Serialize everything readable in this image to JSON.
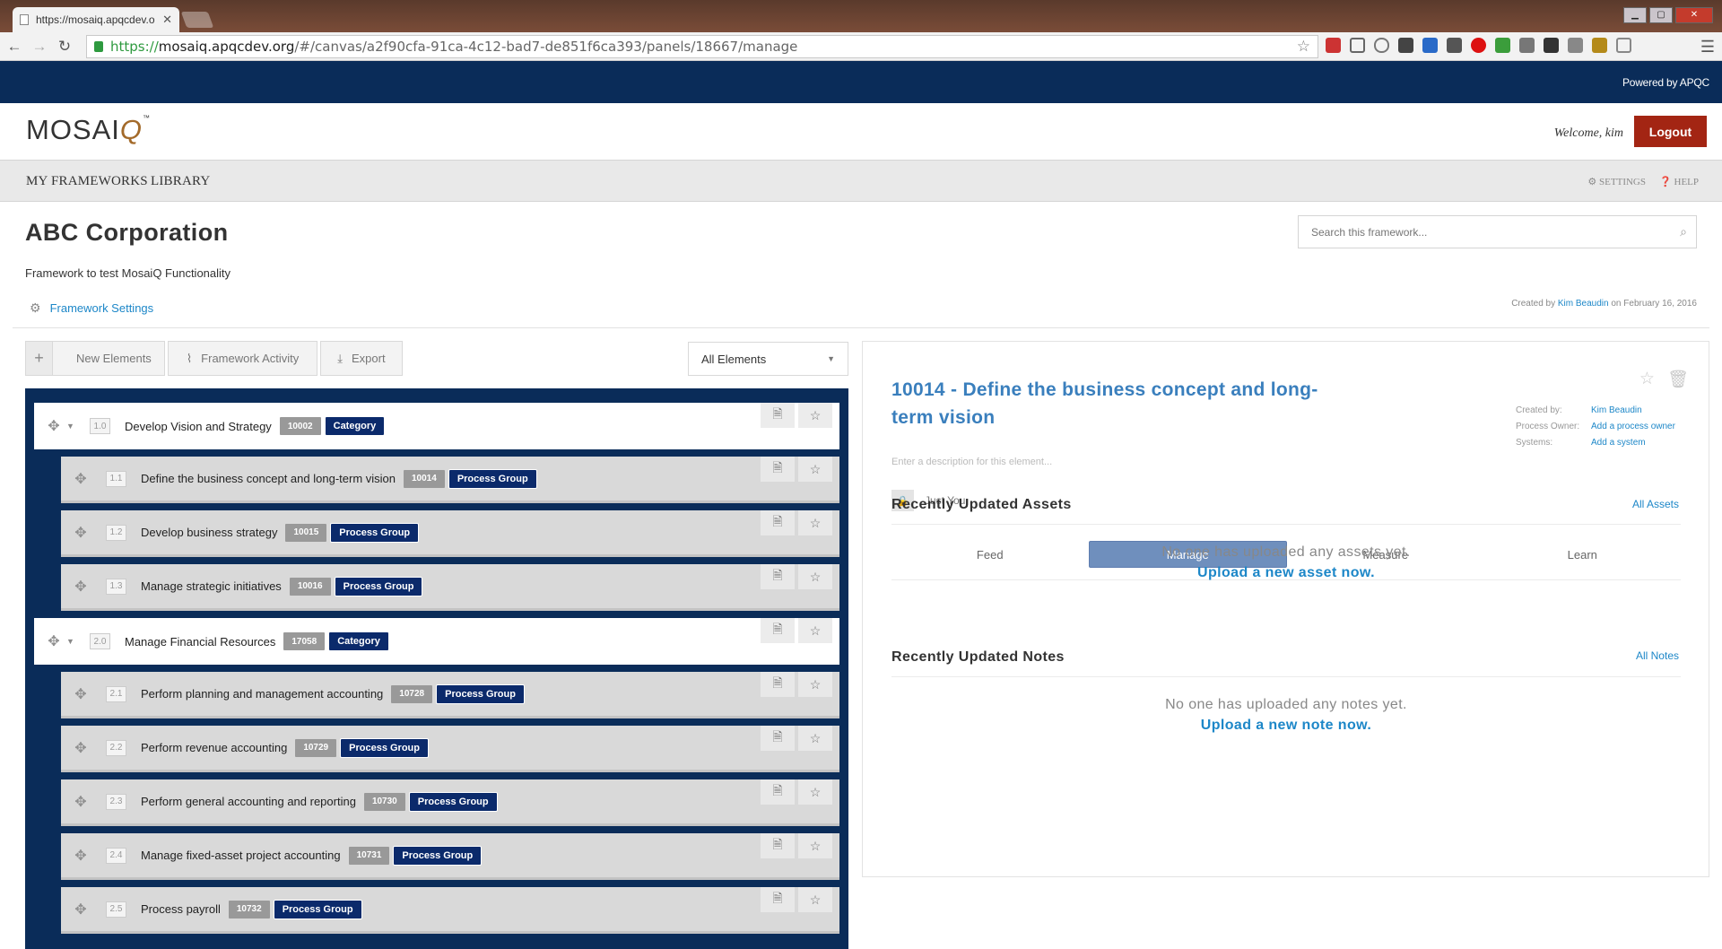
{
  "browser": {
    "tab_title": "https://mosaiq.apqcdev.o",
    "tab_close": "✕",
    "url_secure": "https://",
    "url_host": "mosaiq.apqcdev.org",
    "url_path": "/#/canvas/a2f90cfa-91ca-4c12-bad7-de851f6ca393/panels/18667/manage"
  },
  "topbar": {
    "powered_by": "Powered by APQC"
  },
  "header": {
    "logo_prefix": "MOSAI",
    "logo_q": "Q",
    "logo_tm": "™",
    "welcome": "Welcome, kim",
    "logout_label": "Logout"
  },
  "nav": {
    "frameworks": "MY FRAMEWORKS",
    "library": "LIBRARY",
    "settings": "SETTINGS",
    "help": "HELP"
  },
  "framework": {
    "title": "ABC Corporation",
    "description": "Framework to test MosaiQ Functionality",
    "settings_link": "Framework Settings",
    "search_placeholder": "Search this framework...",
    "created_prefix": "Created by",
    "created_by": "Kim Beaudin",
    "created_suffix": "on February 16, 2016"
  },
  "toolbar": {
    "new_elements": "New Elements",
    "framework_activity": "Framework Activity",
    "export": "Export",
    "filter": "All Elements"
  },
  "tree": [
    {
      "level": "cat",
      "num": "1.0",
      "label": "Develop Vision and Strategy",
      "id": "10002",
      "type": "Category"
    },
    {
      "level": "pg",
      "num": "1.1",
      "label": "Define the business concept and long-term vision",
      "id": "10014",
      "type": "Process Group"
    },
    {
      "level": "pg",
      "num": "1.2",
      "label": "Develop business strategy",
      "id": "10015",
      "type": "Process Group"
    },
    {
      "level": "pg",
      "num": "1.3",
      "label": "Manage strategic initiatives",
      "id": "10016",
      "type": "Process Group"
    },
    {
      "level": "cat",
      "num": "2.0",
      "label": "Manage Financial Resources",
      "id": "17058",
      "type": "Category"
    },
    {
      "level": "pg",
      "num": "2.1",
      "label": "Perform planning and management accounting",
      "id": "10728",
      "type": "Process Group"
    },
    {
      "level": "pg",
      "num": "2.2",
      "label": "Perform revenue accounting",
      "id": "10729",
      "type": "Process Group"
    },
    {
      "level": "pg",
      "num": "2.3",
      "label": "Perform general accounting and reporting",
      "id": "10730",
      "type": "Process Group"
    },
    {
      "level": "pg",
      "num": "2.4",
      "label": "Manage fixed-asset project accounting",
      "id": "10731",
      "type": "Process Group"
    },
    {
      "level": "pg",
      "num": "2.5",
      "label": "Process payroll",
      "id": "10732",
      "type": "Process Group"
    }
  ],
  "detail": {
    "title": "10014 - Define the business concept and long-term vision",
    "created_by_label": "Created by:",
    "created_by_value": "Kim Beaudin",
    "owner_label": "Process Owner:",
    "owner_value": "Add a process owner",
    "systems_label": "Systems:",
    "systems_value": "Add a system",
    "description_placeholder": "Enter a description for this element...",
    "visibility": "Just You",
    "tabs": [
      "Feed",
      "Manage",
      "Measure",
      "Learn"
    ],
    "active_tab": "Manage",
    "assets_heading": "Recently Updated Assets",
    "assets_link": "All Assets",
    "assets_empty": "No one has uploaded any assets yet.",
    "assets_upload": "Upload a new asset now.",
    "notes_heading": "Recently Updated Notes",
    "notes_link": "All Notes",
    "notes_empty": "No one has uploaded any notes yet.",
    "notes_upload": "Upload a new note now."
  },
  "colors": {
    "navy": "#0a2c59",
    "logout_red": "#a32513",
    "link_blue": "#1d87c8",
    "title_blue": "#3a7fbd",
    "badge_navy": "#0b2a6b",
    "tab_active": "#6f8fbd"
  },
  "icons": {
    "move": "move-icon",
    "collapse": "chevron-down-icon",
    "document": "document-icon",
    "favorite": "star-icon",
    "trash": "trash-icon",
    "lock": "lock-icon",
    "gear": "gear-icon",
    "search": "search-icon"
  }
}
